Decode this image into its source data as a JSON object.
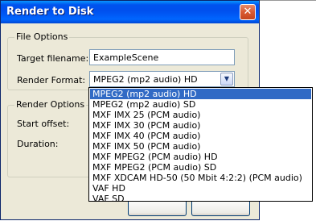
{
  "window": {
    "title": "Render to Disk",
    "close_glyph": "✕"
  },
  "file_options": {
    "group_label": "File Options",
    "target_filename_label": "Target filename:",
    "target_filename_value": "ExampleScene",
    "render_format_label": "Render Format:",
    "render_format_value": "MPEG2 (mp2 audio) HD"
  },
  "render_options": {
    "group_label": "Render Options",
    "start_offset_label": "Start offset:",
    "duration_label": "Duration:"
  },
  "render_format_options": [
    "MPEG2 (mp2 audio) HD",
    "MPEG2 (mp2 audio) SD",
    "MXF IMX 25 (PCM audio)",
    "MXF IMX 30 (PCM audio)",
    "MXF IMX 40 (PCM audio)",
    "MXF IMX 50 (PCM audio)",
    "MXF MPEG2 (PCM audio) HD",
    "MXF MPEG2 (PCM audio) SD",
    "MXF XDCAM HD-50 (50 Mbit 4:2:2) (PCM audio)",
    "VAF HD",
    "VAF SD"
  ],
  "selected_option_index": 0,
  "colors": {
    "title_bar": "#0054e3",
    "selection": "#316ac5",
    "dialog_bg": "#ece9d8"
  }
}
